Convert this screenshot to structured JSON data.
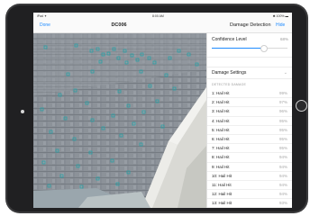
{
  "status_bar": {
    "left": "iPad ✦",
    "time": "8:00 AM",
    "right": "✱ 100% ▬"
  },
  "nav": {
    "done_label": "Done",
    "title": "DC006",
    "panel_title": "Damage Detection",
    "hide_label": "Hide"
  },
  "confidence": {
    "label": "Confidence Level",
    "value_text": "68%",
    "value_fraction": 0.68
  },
  "settings": {
    "label": "Damage Settings",
    "chevron": "⌄"
  },
  "detected": {
    "header": "DETECTED DAMAGE",
    "items": [
      {
        "label": "1: Hail Hit",
        "value": "99%"
      },
      {
        "label": "2: Hail Hit",
        "value": "97%"
      },
      {
        "label": "3: Hail Hit",
        "value": "96%"
      },
      {
        "label": "4: Hail Hit",
        "value": "95%"
      },
      {
        "label": "5: Hail Hit",
        "value": "95%"
      },
      {
        "label": "6: Hail Hit",
        "value": "95%"
      },
      {
        "label": "7: Hail Hit",
        "value": "95%"
      },
      {
        "label": "8: Hail Hit",
        "value": "94%"
      },
      {
        "label": "9: Hail Hit",
        "value": "94%"
      },
      {
        "label": "10: Hail Hit",
        "value": "94%"
      },
      {
        "label": "11: Hail Hit",
        "value": "94%"
      },
      {
        "label": "12: Hail Hit",
        "value": "94%"
      },
      {
        "label": "13: Hail Hit",
        "value": "93%"
      }
    ]
  },
  "colors": {
    "accent": "#1f8bff",
    "marker": "#1fa3a8",
    "roof": "#8f949b",
    "trim": "#e6e6e2",
    "frame": "#3b3b3d"
  },
  "icons": [
    "home-button-icon",
    "camera-dot-icon",
    "chevron-down-icon",
    "hail-marker-icon"
  ]
}
